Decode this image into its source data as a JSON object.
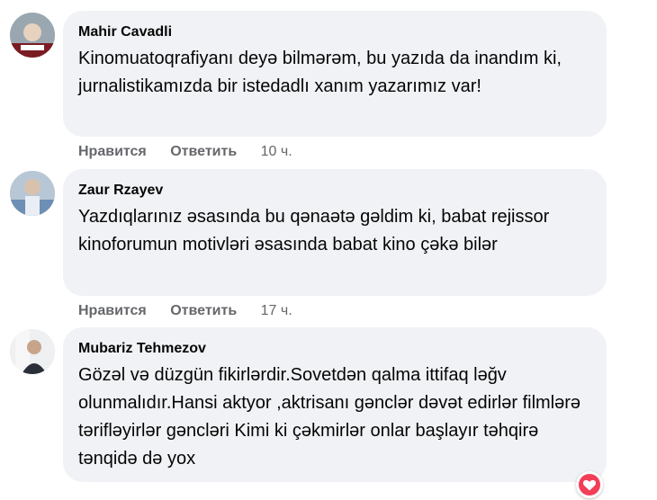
{
  "comments": [
    {
      "author": "Mahir Cavadli",
      "text": "Kinomuatoqrafiyanı deyə bilmərəm, bu yazıda da inandım ki, jurnalistikamızda bir istedadlı xanım yazarımız var!",
      "like_label": "Нравится",
      "reply_label": "Ответить",
      "time": "10 ч."
    },
    {
      "author": "Zaur Rzayev",
      "text": "Yazdıqlarınız əsasında bu qənaətə gəldim ki, babat rejissor kinoforumun motivləri əsasında babat kino çəkə bilər",
      "like_label": "Нравится",
      "reply_label": "Ответить",
      "time": "17 ч."
    },
    {
      "author": "Mubariz Tehmezov",
      "text": "Gözəl və düzgün fikirlərdir.Sovetdən qalma ittifaq ləğv olunmalıdır.Hansi aktyor ,aktrisanı gənclər dəvət edirlər filmlərə tərifləyirlər gəncləri Kimi ki çəkmirlər onlar başlayır təhqirə tənqidə də yox"
    }
  ],
  "reaction": {
    "icon": "love-reaction-icon",
    "color": "#f33e58"
  }
}
